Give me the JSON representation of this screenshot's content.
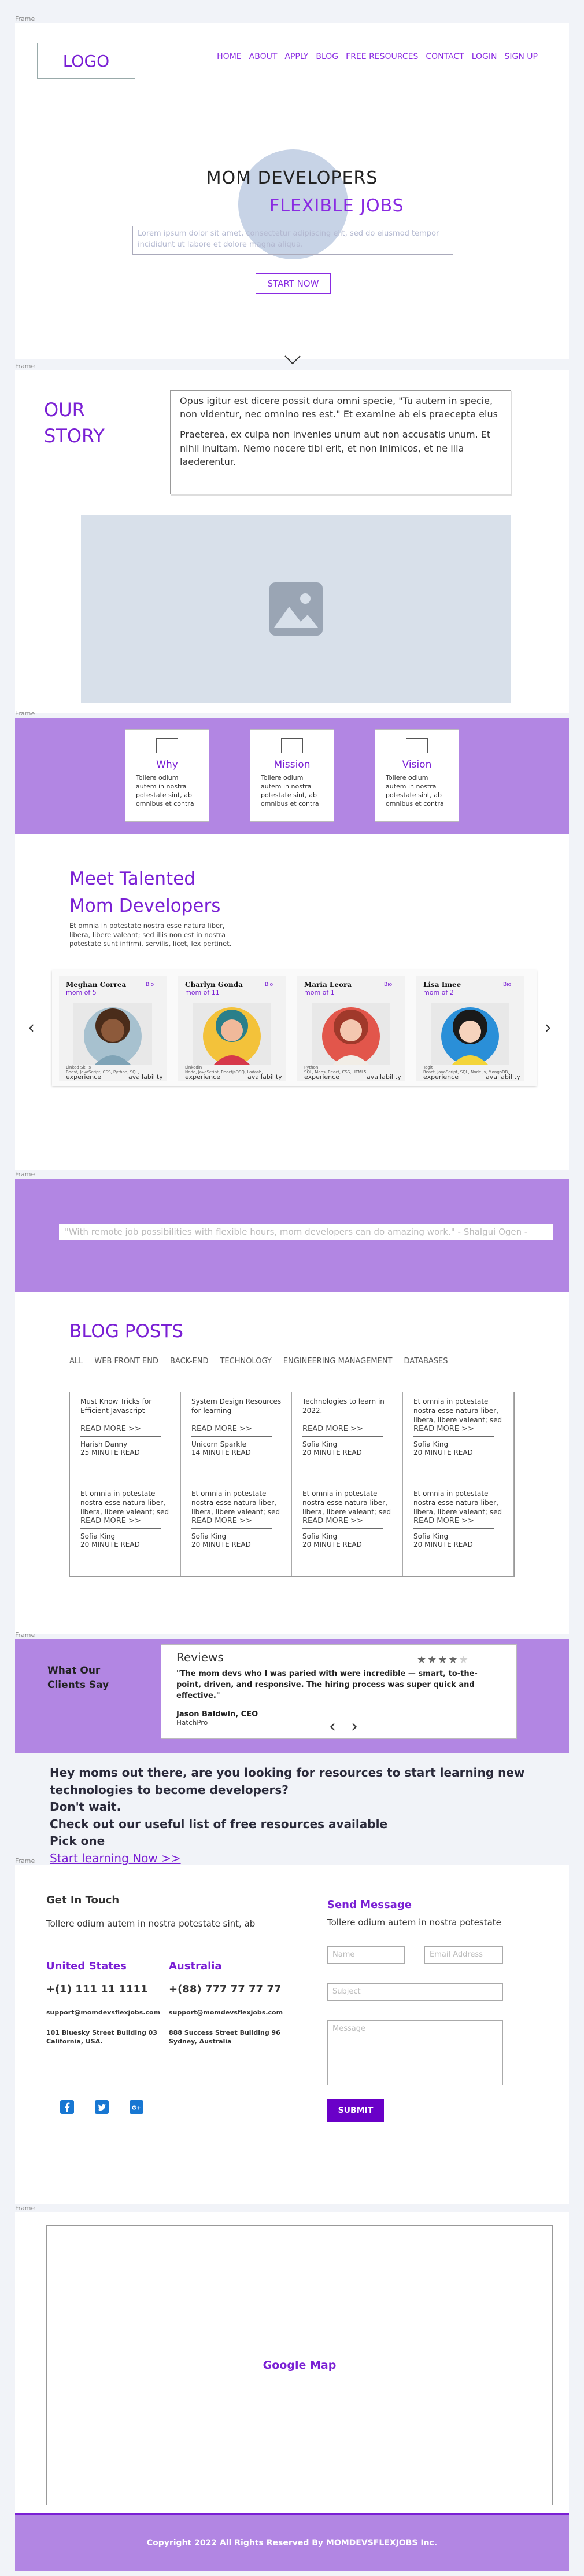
{
  "frames": {
    "label": "Frame"
  },
  "header": {
    "logo": "LOGO",
    "nav": [
      "HOME",
      "ABOUT",
      "APPLY",
      "BLOG",
      "FREE RESOURCES",
      "CONTACT",
      "LOGIN",
      "SIGN UP"
    ]
  },
  "hero": {
    "title": "MOM DEVELOPERS",
    "subtitle": "FLEXIBLE JOBS",
    "placeholder_text": "Lorem ipsum dolor sit amet, consectetur adipiscing elit, sed do eiusmod tempor incididunt ut labore et dolore magna aliqua.",
    "cta": "START NOW",
    "scroll_icon": "chevron-down-icon"
  },
  "story": {
    "title_line1": "OUR",
    "title_line2": "STORY",
    "para1": "Opus igitur est dicere possit dura omni specie, \"Tu autem in specie, non videntur, nec omnino res est.\" Et examine ab eis praecepta eius",
    "para2": "Praeterea, ex culpa non invenies unum aut non accusatis unum. Et nihil inuitam. Nemo nocere tibi erit, et non inimicos, et ne illa laederentur.",
    "image_icon": "image-placeholder-icon"
  },
  "values": [
    {
      "title": "Why",
      "text": "Tollere odium autem in nostra potestate sint, ab omnibus et contra"
    },
    {
      "title": "Mission",
      "text": "Tollere odium autem in nostra potestate sint, ab omnibus et contra"
    },
    {
      "title": "Vision",
      "text": "Tollere odium autem in nostra potestate sint, ab omnibus et contra"
    }
  ],
  "meet": {
    "title_line1": "Meet Talented",
    "title_line2": "Mom Developers",
    "desc": "Et omnia in potestate nostra esse natura liber, libera, libere valeant; sed illis non est in nostra potestate sunt infirmi, servilis, licet, lex pertinet.",
    "experience_label": "experience",
    "availability_label": "availability",
    "devs": [
      {
        "name": "Meghan Correa",
        "tag": "Bio",
        "mom_of": "mom of 5",
        "label1": "Linked Skills",
        "label2": "Boost, JavaScript, CSS, Python, SQL,"
      },
      {
        "name": "Charlyn Gonda",
        "tag": "Bio",
        "mom_of": "mom of 11",
        "label1": "Linkedin",
        "label2": "Node, JavaScript, ReactjsDSQ, Lodash,"
      },
      {
        "name": "Maria Leora",
        "tag": "Bio",
        "mom_of": "mom of 1",
        "label1": "Python",
        "label2": "SQL, Maps, React, CSS, HTML5"
      },
      {
        "name": "Lisa Imee",
        "tag": "Bio",
        "mom_of": "mom of 2",
        "label1": "Tagit",
        "label2": "React, JavaScript, SQL, Node.js, MongoDB,"
      }
    ]
  },
  "quote": {
    "text": "\"With remote job possibilities with flexible hours, mom developers can do amazing work.\" - Shalgui Ogen -"
  },
  "blog": {
    "title": "BLOG POSTS",
    "categories": [
      "ALL",
      "WEB FRONT END",
      "BACK-END",
      "TECHNOLOGY",
      "ENGINEERING MANAGEMENT",
      "DATABASES"
    ],
    "read_more": "READ MORE >>",
    "posts": [
      {
        "title": "Must Know Tricks for Efficient Javascript",
        "author": "Harish Danny",
        "time": "25 MINUTE READ"
      },
      {
        "title": "System Design Resources for learning",
        "author": "Unicorn Sparkle",
        "time": "14 MINUTE READ"
      },
      {
        "title": "Technologies to learn in 2022.",
        "author": "Sofia King",
        "time": "20 MINUTE READ"
      },
      {
        "title": "Et omnia in potestate nostra esse natura liber, libera, libere valeant; sed",
        "author": "Sofia King",
        "time": "20 MINUTE READ"
      },
      {
        "title": "Et omnia in potestate nostra esse natura liber, libera, libere valeant; sed",
        "author": "Sofia King",
        "time": "20 MINUTE READ"
      },
      {
        "title": "Et omnia in potestate nostra esse natura liber, libera, libere valeant; sed",
        "author": "Sofia King",
        "time": "20 MINUTE READ"
      },
      {
        "title": "Et omnia in potestate nostra esse natura liber, libera, libere valeant; sed",
        "author": "Sofia King",
        "time": "20 MINUTE READ"
      },
      {
        "title": "Et omnia in potestate nostra esse natura liber, libera, libere valeant; sed",
        "author": "Sofia King",
        "time": "20 MINUTE READ"
      }
    ]
  },
  "testimonials": {
    "heading_line1": "What Our",
    "heading_line2": "Clients Say",
    "title": "Reviews",
    "rating": 4,
    "max_rating": 5,
    "quote": "\"The mom devs who I was paried with were incredible — smart, to-the-point, driven, and responsive. The hiring process was super quick and effective.\"",
    "author": "Jason Baldwin, CEO",
    "company": "HatchPro"
  },
  "cta": {
    "line1": "Hey moms out there, are you looking for resources to start learning new technologies to become developers?",
    "line2": "Don't wait.",
    "line3": "Check out our useful list of free resources available",
    "line4": "Pick one",
    "link": "Start learning Now >>"
  },
  "contact": {
    "heading": "Get In Touch",
    "text": "Tollere odium autem in nostra potestate sint, ab",
    "offices": [
      {
        "country": "United States",
        "phone": "+(1) 111 11 1111",
        "email": "support@momdevsflexjobs.com",
        "address1": "101 Bluesky Street Building 03",
        "address2": "California, USA."
      },
      {
        "country": "Australia",
        "phone": "+(88) 777 77 77 77",
        "email": "support@momdevsflexjobs.com",
        "address1": "888 Success Street Building 96",
        "address2": "Sydney, Australia"
      }
    ],
    "social_icons": [
      "facebook-icon",
      "twitter-icon",
      "google-plus-icon"
    ],
    "form_title": "Send Message",
    "form_sub": "Tollere odium autem in nostra potestate",
    "name_placeholder": "Name",
    "email_placeholder": "Email Address",
    "subject_placeholder": "Subject",
    "message_placeholder": "Message",
    "submit": "SUBMIT"
  },
  "map": {
    "label": "Google Map"
  },
  "footer": {
    "text": "Copyright 2022 All Rights Reserved By MOMDEVSFLEXJOBS Inc."
  },
  "colors": {
    "brand": "#7a1fd4",
    "accent_bg": "#b286e3",
    "page_bg": "#f1f3f8"
  }
}
